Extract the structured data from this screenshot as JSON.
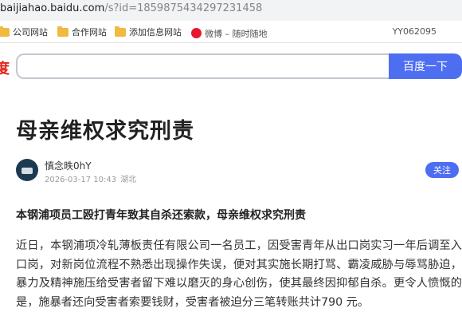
{
  "url": {
    "host": "baijiahao.baidu.com",
    "path": "/s?id=1859875434297231458"
  },
  "bookmarks": {
    "items": [
      {
        "label": "公司网站",
        "icon": "folder-icon"
      },
      {
        "label": "合作网站",
        "icon": "folder-icon"
      },
      {
        "label": "添加信息网站",
        "icon": "folder-icon"
      },
      {
        "label": "微博 – 随时随地",
        "icon": "weibo-icon"
      }
    ],
    "account": "YY062095"
  },
  "search": {
    "brand_fragment": "度",
    "value": "",
    "button_label": "百度一下"
  },
  "article": {
    "title": "母亲维权求究刑责",
    "author": "慎念昳0hY",
    "date": "2026-03-17 10:43",
    "location": "湖北",
    "follow_label": "关注",
    "lead": "本钢浦项员工殴打青年致其自杀还索款，母亲维权求究刑责",
    "body": "近日，本钢浦项冷轧薄板责任有限公司一名员工，因受害青年从出口岗实习一年后调至入口岗，对新岗位流程不熟悉出现操作失误，便对其实施长期打骂、霸凌威胁与辱骂胁迫，暴力及精神施压给受害者留下难以磨灭的身心创伤，使其最终因抑郁自杀。更令人愤慨的是，施暴者还向受害者索要钱财，受害者被迫分三笔转账共计790 元。"
  },
  "colors": {
    "accent": "#4e6ef2",
    "brand_red": "#e1251b",
    "url_bar": "#f1f3f4"
  }
}
